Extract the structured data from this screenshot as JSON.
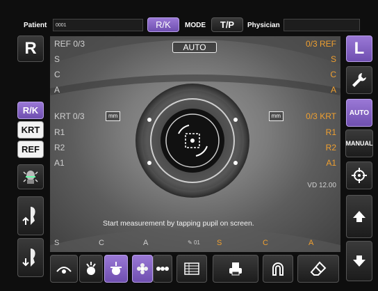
{
  "topbar": {
    "patient_label": "Patient",
    "patient_value": "0001",
    "mode_rk": "R/K",
    "mode_label": "MODE",
    "mode_tp": "T/P",
    "physician_label": "Physician",
    "physician_value": ""
  },
  "left_eye_button": "R",
  "right_eye_button": "L",
  "measure_tabs": [
    "R/K",
    "KRT",
    "REF"
  ],
  "right_mode": {
    "auto": "AUTO",
    "manual": "MANUAL"
  },
  "viewport": {
    "auto_badge": "AUTO",
    "ref_left": {
      "title": "REF",
      "count": "0/3",
      "rows": [
        "S",
        "C",
        "A"
      ]
    },
    "ref_right": {
      "title": "REF",
      "count": "0/3",
      "rows": [
        "S",
        "C",
        "A"
      ]
    },
    "krt_left": {
      "title": "KRT",
      "count": "0/3",
      "unit": "mm",
      "rows": [
        "R1",
        "R2",
        "A1"
      ]
    },
    "krt_right": {
      "title": "KRT",
      "count": "0/3",
      "unit": "mm",
      "rows": [
        "R1",
        "R2",
        "A1"
      ]
    },
    "vd": "VD 12.00",
    "instruction": "Start measurement by tapping pupil on screen.",
    "bottom_left": [
      "S",
      "C",
      "A"
    ],
    "bottom_mid": "01",
    "bottom_right": [
      "S",
      "C",
      "A"
    ]
  },
  "colors": {
    "accent": "#7d5cc4",
    "orange": "#f0a030"
  },
  "icons": {
    "tools": "wrench-icon",
    "target": "crosshair-icon",
    "up": "up-arrow-icon",
    "down": "down-arrow-icon"
  }
}
